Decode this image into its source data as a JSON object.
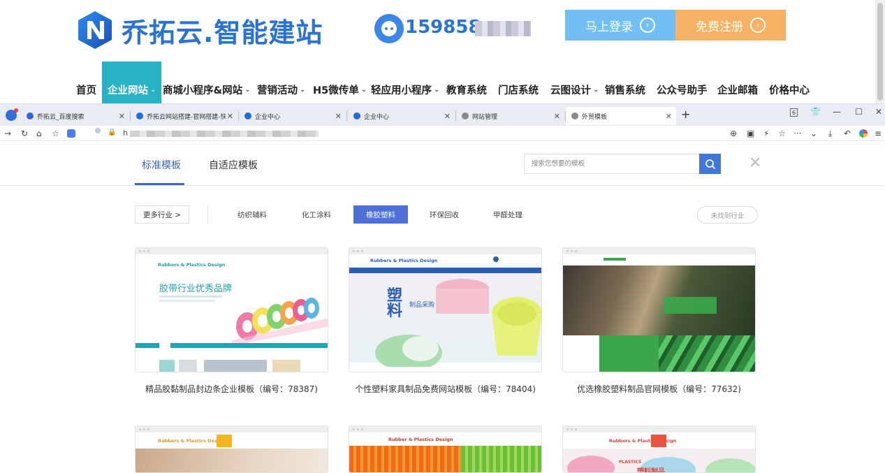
{
  "site": {
    "logo_text": "乔拓云.智能建站",
    "phone": "159858",
    "login_label": "马上登录",
    "register_label": "免费注册",
    "nav": [
      {
        "label": "首页",
        "dropdown": false
      },
      {
        "label": "企业网站",
        "dropdown": true,
        "active": true
      },
      {
        "label": "商城小程序&网站",
        "dropdown": true
      },
      {
        "label": "营销活动",
        "dropdown": true
      },
      {
        "label": "H5微传单",
        "dropdown": true
      },
      {
        "label": "轻应用小程序",
        "dropdown": true
      },
      {
        "label": "教育系统",
        "dropdown": false
      },
      {
        "label": "门店系统",
        "dropdown": false
      },
      {
        "label": "云图设计",
        "dropdown": true
      },
      {
        "label": "销售系统",
        "dropdown": false
      },
      {
        "label": "公众号助手",
        "dropdown": false
      },
      {
        "label": "企业邮箱",
        "dropdown": false
      },
      {
        "label": "价格中心",
        "dropdown": false
      }
    ],
    "colors": {
      "brand": "#2a73d6",
      "nav_active": "#27b3c5",
      "login": "#71bff5",
      "register": "#f7b163"
    }
  },
  "browser": {
    "tabs": [
      {
        "title": "乔拓云_百度搜索",
        "active": false
      },
      {
        "title": "乔拓云网站搭建-官网搭建-快",
        "active": false
      },
      {
        "title": "企业中心",
        "active": false
      },
      {
        "title": "企业中心",
        "active": false
      },
      {
        "title": "网站管理",
        "active": false
      },
      {
        "title": "外贸模板",
        "active": true
      }
    ],
    "tab_count_badge": "6",
    "url_prefix": "h"
  },
  "templates": {
    "tabs": [
      "标准模板",
      "自适应模板"
    ],
    "active_tab": 0,
    "search_placeholder": "搜索您想要的模板",
    "more_industries": "更多行业 >",
    "industries": [
      "纺织辅料",
      "化工涂料",
      "橡胶塑料",
      "环保回收",
      "甲醛处理"
    ],
    "active_industry": 2,
    "not_found": "未找到行业",
    "accent": "#4e6fd6",
    "cards": [
      {
        "title": "精品胶黏制品封边条企业模板（编号：78387)",
        "brand": "Rubbers & Plastics Design",
        "headline": "胶带行业优秀品牌"
      },
      {
        "title": "个性塑料家具制品免费网站模板（编号：78404)",
        "brand": "Rubbers & Plastics Design",
        "headline": "塑料",
        "sub": "制品采购"
      },
      {
        "title": "优选橡胶塑料制品官网模板（编号：77632)",
        "brand": "",
        "headline": ""
      },
      {
        "title": "",
        "brand": "Rubbers & Plastics Design"
      },
      {
        "title": "",
        "brand": "Rubber & Plastics Design"
      },
      {
        "title": "",
        "brand": "Rubbers & Plastics Design",
        "headline": "塑料制品",
        "sub": "PLASTICS"
      }
    ]
  }
}
